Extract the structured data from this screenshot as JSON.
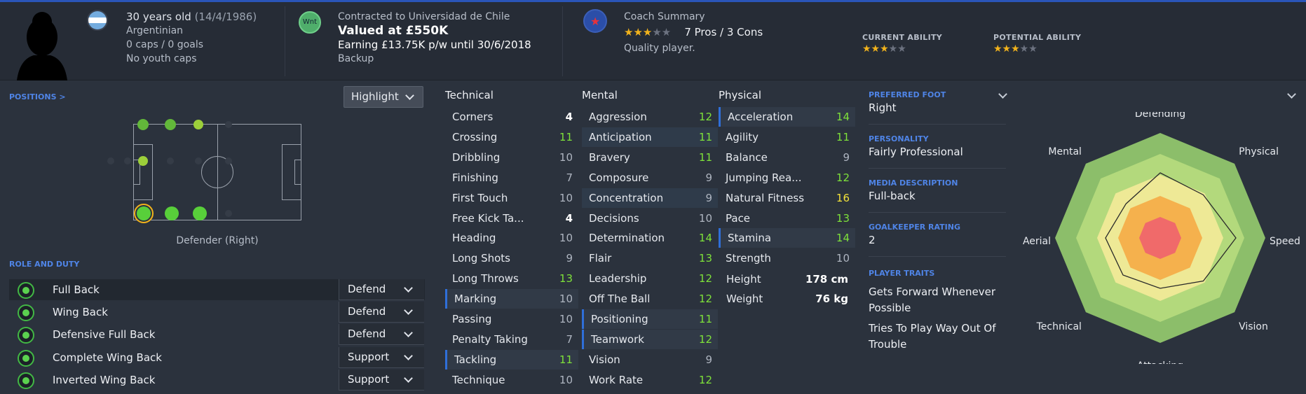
{
  "header": {
    "age": "30 years old",
    "dob": "(14/4/1986)",
    "nationality": "Argentinian",
    "caps": "0 caps / 0 goals",
    "youth": "No youth caps",
    "contract_badge": "Wnt",
    "contracted_to": "Contracted to Universidad de Chile",
    "valued": "Valued at £550K",
    "earning": "Earning £13.75K p/w until 30/6/2018",
    "squad_status": "Backup",
    "coach_summary_title": "Coach Summary",
    "coach_stars": 3,
    "pros_cons": "7 Pros / 3 Cons",
    "quality": "Quality player.",
    "current_ability_label": "CURRENT ABILITY",
    "current_ability_stars": 3,
    "potential_ability_label": "POTENTIAL ABILITY",
    "potential_ability_stars": 3
  },
  "positions": {
    "title": "POSITIONS >",
    "highlight_label": "Highlight",
    "position_name": "Defender (Right)"
  },
  "roles": {
    "title": "ROLE AND DUTY",
    "items": [
      {
        "name": "Full Back",
        "duty": "Defend"
      },
      {
        "name": "Wing Back",
        "duty": "Defend"
      },
      {
        "name": "Defensive Full Back",
        "duty": "Defend"
      },
      {
        "name": "Complete Wing Back",
        "duty": "Support"
      },
      {
        "name": "Inverted Wing Back",
        "duty": "Support"
      }
    ]
  },
  "attributes": {
    "technical_title": "Technical",
    "mental_title": "Mental",
    "physical_title": "Physical",
    "technical": [
      {
        "name": "Corners",
        "value": "4"
      },
      {
        "name": "Crossing",
        "value": "11"
      },
      {
        "name": "Dribbling",
        "value": "10"
      },
      {
        "name": "Finishing",
        "value": "7"
      },
      {
        "name": "First Touch",
        "value": "10"
      },
      {
        "name": "Free Kick Ta...",
        "value": "4"
      },
      {
        "name": "Heading",
        "value": "10"
      },
      {
        "name": "Long Shots",
        "value": "9"
      },
      {
        "name": "Long Throws",
        "value": "13"
      },
      {
        "name": "Marking",
        "value": "10"
      },
      {
        "name": "Passing",
        "value": "10"
      },
      {
        "name": "Penalty Taking",
        "value": "7"
      },
      {
        "name": "Tackling",
        "value": "11"
      },
      {
        "name": "Technique",
        "value": "10"
      }
    ],
    "mental": [
      {
        "name": "Aggression",
        "value": "12"
      },
      {
        "name": "Anticipation",
        "value": "11"
      },
      {
        "name": "Bravery",
        "value": "11"
      },
      {
        "name": "Composure",
        "value": "9"
      },
      {
        "name": "Concentration",
        "value": "9"
      },
      {
        "name": "Decisions",
        "value": "10"
      },
      {
        "name": "Determination",
        "value": "14"
      },
      {
        "name": "Flair",
        "value": "13"
      },
      {
        "name": "Leadership",
        "value": "12"
      },
      {
        "name": "Off The Ball",
        "value": "12"
      },
      {
        "name": "Positioning",
        "value": "11"
      },
      {
        "name": "Teamwork",
        "value": "12"
      },
      {
        "name": "Vision",
        "value": "9"
      },
      {
        "name": "Work Rate",
        "value": "12"
      }
    ],
    "physical": [
      {
        "name": "Acceleration",
        "value": "14"
      },
      {
        "name": "Agility",
        "value": "11"
      },
      {
        "name": "Balance",
        "value": "9"
      },
      {
        "name": "Jumping Rea...",
        "value": "12"
      },
      {
        "name": "Natural Fitness",
        "value": "16"
      },
      {
        "name": "Pace",
        "value": "13"
      },
      {
        "name": "Stamina",
        "value": "14"
      },
      {
        "name": "Strength",
        "value": "10"
      }
    ],
    "height_label": "Height",
    "height_value": "178 cm",
    "weight_label": "Weight",
    "weight_value": "76 kg"
  },
  "profile": {
    "preferred_foot_label": "PREFERRED FOOT",
    "preferred_foot": "Right",
    "personality_label": "PERSONALITY",
    "personality": "Fairly Professional",
    "media_label": "MEDIA DESCRIPTION",
    "media": "Full-back",
    "gk_label": "GOALKEEPER RATING",
    "gk_rating": "2",
    "traits_label": "PLAYER TRAITS",
    "trait_1": "Gets Forward Whenever Possible",
    "trait_2": "Tries To Play Way Out Of Trouble"
  },
  "radar": {
    "labels": [
      "Defending",
      "Physical",
      "Speed",
      "Vision",
      "Attacking",
      "Technical",
      "Aerial",
      "Mental"
    ],
    "values": [
      0.62,
      0.58,
      0.72,
      0.58,
      0.48,
      0.5,
      0.52,
      0.46
    ],
    "colors": {
      "outer": "#8cbe6a",
      "ring2": "#b3d97c",
      "ring3": "#eee996",
      "ring4": "#f5b14d",
      "core": "#f06a6a"
    }
  },
  "colors": {
    "accent_blue": "#4f84e6",
    "attr_green": "#7ee13a",
    "attr_yellow": "#f2e23a",
    "star_gold": "#f2b31c"
  }
}
